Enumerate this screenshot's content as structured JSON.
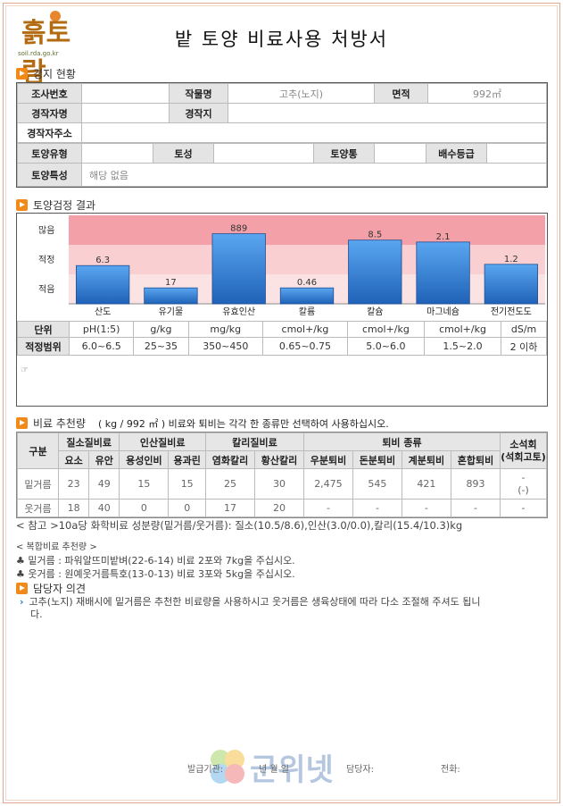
{
  "header": {
    "logo_text": "흙토람",
    "logo_url": "soil.rda.go.kr",
    "title": "밭 토양 비료사용 처방서"
  },
  "farm": {
    "section_title": "경지 현황",
    "survey_no_label": "조사번호",
    "survey_no": "",
    "crop_label": "작물명",
    "crop": "고추(노지)",
    "area_label": "면적",
    "area": "992㎡",
    "farmer_label": "경작자명",
    "farmer": "",
    "farmland_label": "경작지",
    "farmland": "",
    "address_label": "경작자주소",
    "address": "",
    "soil_type_label": "토양유형",
    "soil_type": "",
    "soil_texture_label": "토성",
    "soil_texture": "",
    "soil_series_label": "토양통",
    "soil_series": "",
    "drainage_label": "배수등급",
    "drainage": "",
    "soil_feature_label": "토양특성",
    "soil_feature": "해당 없음"
  },
  "soil_test": {
    "section_title": "토양검정 결과",
    "levels": [
      "많음",
      "적정",
      "적음"
    ],
    "unit_label": "단위",
    "range_label": "적정범위",
    "items": [
      {
        "name": "산도",
        "value": "6.3",
        "unit": "pH(1:5)",
        "range": "6.0~6.5"
      },
      {
        "name": "유기물",
        "value": "17",
        "unit": "g/kg",
        "range": "25~35"
      },
      {
        "name": "유효인산",
        "value": "889",
        "unit": "mg/kg",
        "range": "350~450"
      },
      {
        "name": "칼륨",
        "value": "0.46",
        "unit": "cmol+/kg",
        "range": "0.65~0.75"
      },
      {
        "name": "칼슘",
        "value": "8.5",
        "unit": "cmol+/kg",
        "range": "5.0~6.0"
      },
      {
        "name": "마그네슘",
        "value": "2.1",
        "unit": "cmol+/kg",
        "range": "1.5~2.0"
      },
      {
        "name": "전기전도도",
        "value": "1.2",
        "unit": "dS/m",
        "range": "2 이하"
      }
    ],
    "note_mark": "☞"
  },
  "chart_data": {
    "type": "bar",
    "categories": [
      "산도",
      "유기물",
      "유효인산",
      "칼륨",
      "칼슘",
      "마그네슘",
      "전기전도도"
    ],
    "values_labels": [
      "6.3",
      "17",
      "889",
      "0.46",
      "8.5",
      "2.1",
      "1.2"
    ],
    "relative_level": [
      0.6,
      0.25,
      1.1,
      0.25,
      1.0,
      0.97,
      0.62
    ],
    "bands": [
      "많음",
      "적정",
      "적음"
    ],
    "colors": {
      "bar": "#2f7fd6",
      "high": "#f4a0a8",
      "mid": "#f9cfd2",
      "low": "#fbe3e4"
    }
  },
  "fertilizer": {
    "section_title": "비료 추천량",
    "unit_note": "( kg / 992 ㎡ ) 비료와 퇴비는 각각 한 종류만 선택하여 사용하십시오.",
    "col_group": "구분",
    "groups": [
      "질소질비료",
      "인산질비료",
      "칼리질비료",
      "퇴비 종류",
      "소석회"
    ],
    "lime_sub": "(석회고토)",
    "subcols": [
      "요소",
      "유안",
      "용성인비",
      "용과린",
      "염화칼리",
      "황산칼리",
      "우분퇴비",
      "돈분퇴비",
      "계분퇴비",
      "혼합퇴비"
    ],
    "rows": [
      {
        "label": "밑거름",
        "vals": [
          "23",
          "49",
          "15",
          "15",
          "25",
          "30",
          "2,475",
          "545",
          "421",
          "893"
        ],
        "lime": "-",
        "lime2": "(-)"
      },
      {
        "label": "웃거름",
        "vals": [
          "18",
          "40",
          "0",
          "0",
          "17",
          "20",
          "-",
          "-",
          "-",
          "-"
        ],
        "lime": "-",
        "lime2": ""
      }
    ],
    "ref_note": "< 참고 >10a당 화학비료 성분량(밑거름/웃거름): 질소(10.5/8.6),인산(3.0/0.0),칼리(15.4/10.3)kg",
    "compound_title": "< 복합비료 추천량 >",
    "compound1": "♣ 밑거름 : 파워알뜨미밭벼(22-6-14) 비료 2포와 7kg을 주십시오.",
    "compound2": "♣ 웃거름 : 원예웃거름특호(13-0-13) 비료 3포와 5kg을 주십시오."
  },
  "opinion": {
    "section_title": "담당자 의견",
    "text": "고추(노지) 재배시에 밑거름은 추천한 비료량을 사용하시고 웃거름은 생육상태에 따라 다소 조절해 주셔도 됩니",
    "text2": "다."
  },
  "footer": {
    "issuer": "발급기관:",
    "date": "년   월   일",
    "manager": "담당자:",
    "phone": "전화:",
    "watermark": "군위넷"
  }
}
